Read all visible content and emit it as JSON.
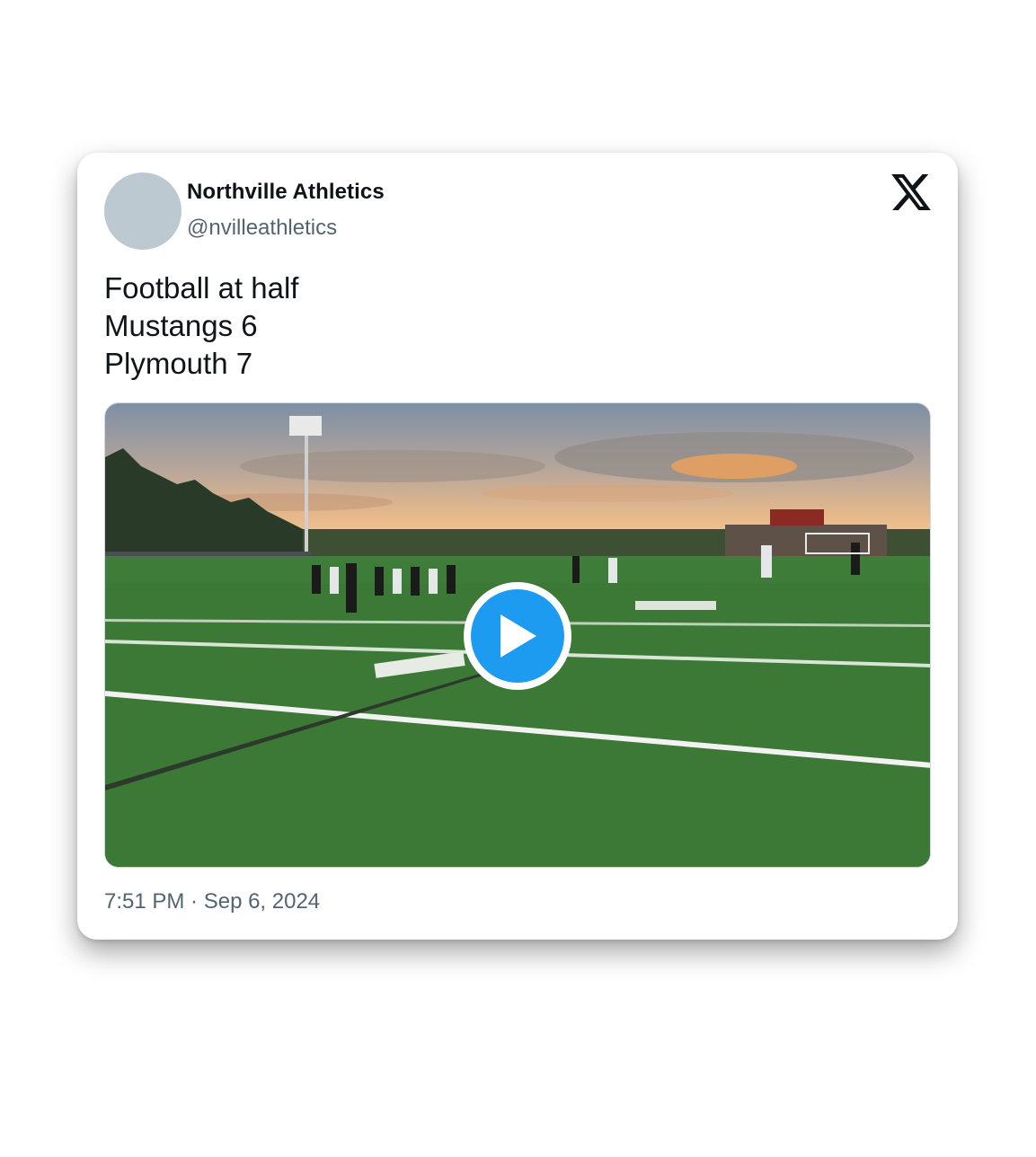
{
  "tweet": {
    "author_name": "Northville Athletics",
    "author_handle": "@nvilleathletics",
    "text_lines": [
      "Football at half",
      "Mustangs 6",
      "Plymouth 7"
    ],
    "timestamp": "7:51 PM · Sep 6, 2024"
  },
  "icons": {
    "brand": "x-logo-icon",
    "media_control": "play-icon"
  },
  "colors": {
    "accent": "#1d9bf0",
    "text_primary": "#0f1419",
    "text_secondary": "#536471",
    "avatar_placeholder": "#bcc9d1"
  }
}
